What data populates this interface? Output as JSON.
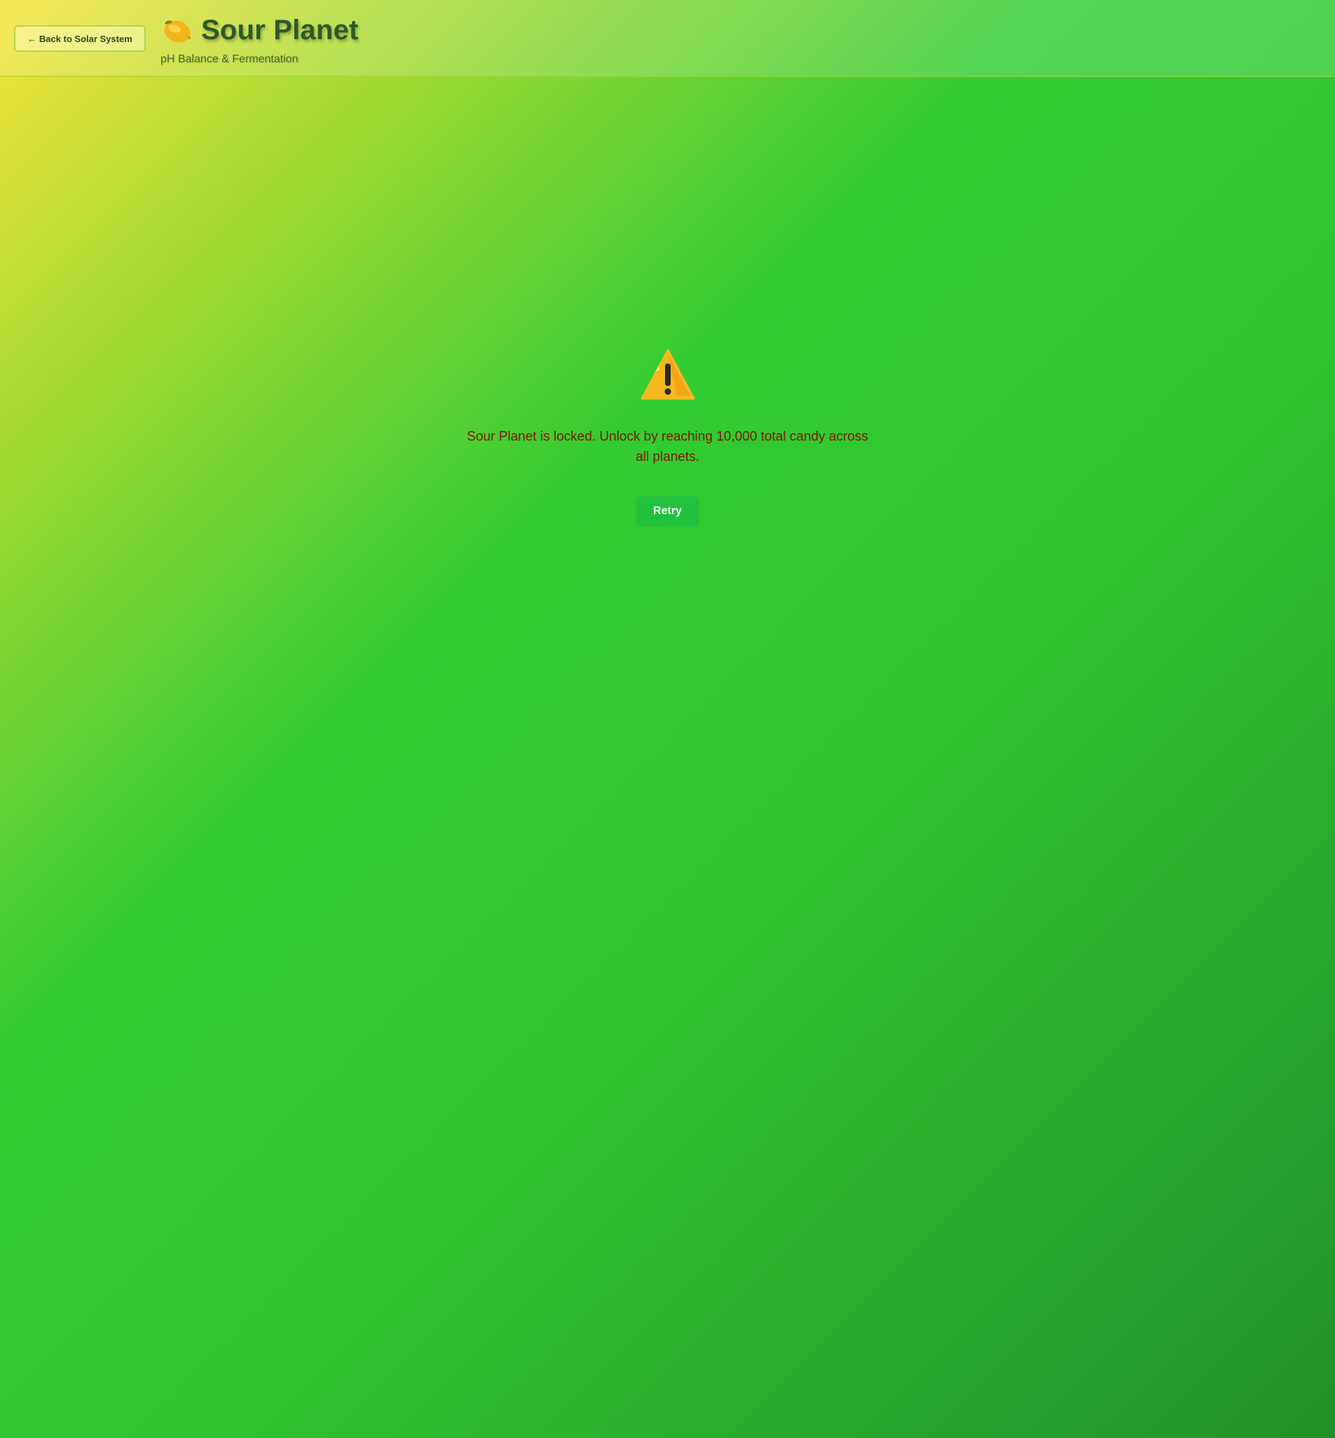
{
  "header": {
    "back_label": "← Back to Solar System",
    "title": "Sour Planet",
    "title_icon": "lemon-icon",
    "subtitle": "pH Balance & Fermentation"
  },
  "error": {
    "icon": "warning-icon",
    "message": "Sour Planet is locked. Unlock by reaching 10,000 total candy across all planets.",
    "retry_label": "Retry"
  },
  "colors": {
    "gradient_start": "#f7e43a",
    "gradient_mid": "#33cc33",
    "gradient_end": "#22902a",
    "title": "#2d5a2a",
    "subtitle": "#4a6a2a",
    "error_text": "#7a1a00",
    "retry_button": "#22c23d",
    "warning_yellow": "#f6b81f"
  }
}
